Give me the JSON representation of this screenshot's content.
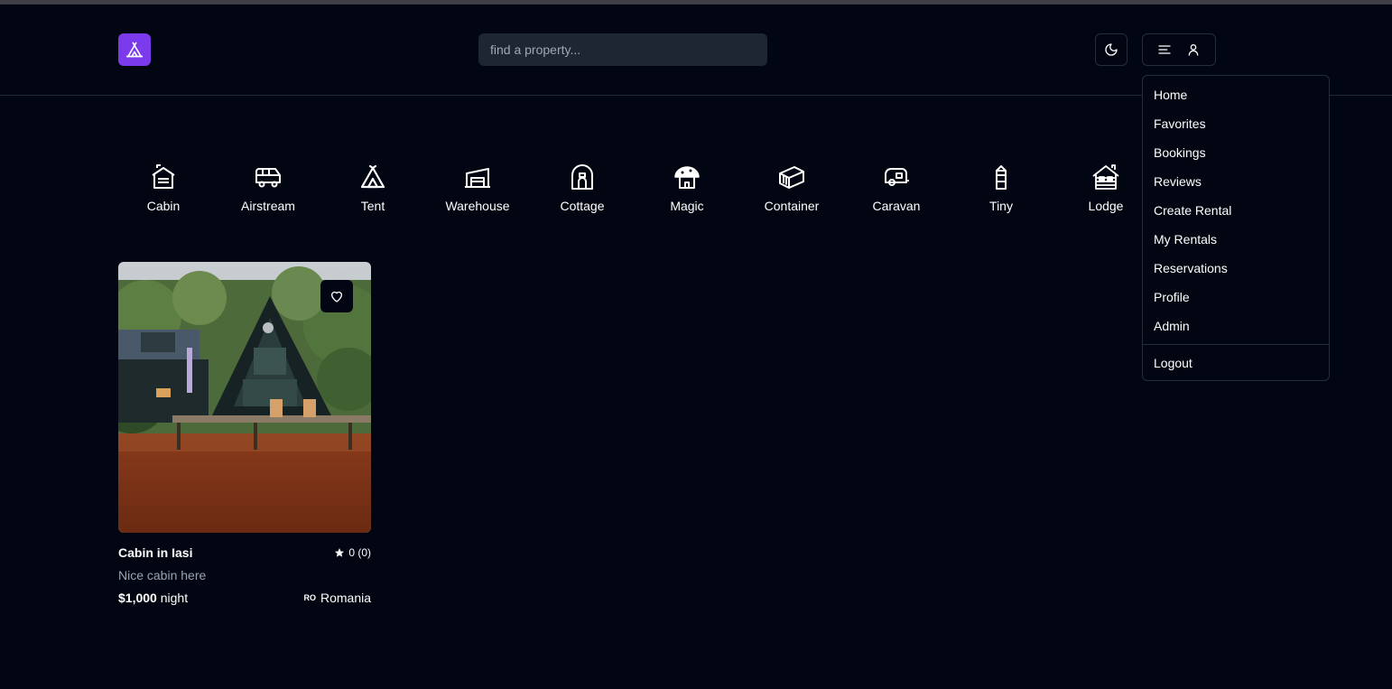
{
  "header": {
    "logo_icon": "tent-icon",
    "search_placeholder": "find a property...",
    "theme_icon": "moon-icon",
    "menu_icon": "menu-lines-icon",
    "user_icon": "user-icon"
  },
  "menu": {
    "items": [
      "Home",
      "Favorites",
      "Bookings",
      "Reviews",
      "Create Rental",
      "My Rentals",
      "Reservations",
      "Profile",
      "Admin"
    ],
    "logout": "Logout"
  },
  "categories": [
    {
      "label": "Cabin",
      "icon": "cabin-icon"
    },
    {
      "label": "Airstream",
      "icon": "airstream-icon"
    },
    {
      "label": "Tent",
      "icon": "tent-icon"
    },
    {
      "label": "Warehouse",
      "icon": "warehouse-icon"
    },
    {
      "label": "Cottage",
      "icon": "cottage-icon"
    },
    {
      "label": "Magic",
      "icon": "mushroom-house-icon"
    },
    {
      "label": "Container",
      "icon": "container-icon"
    },
    {
      "label": "Caravan",
      "icon": "caravan-icon"
    },
    {
      "label": "Tiny",
      "icon": "tiny-house-icon"
    },
    {
      "label": "Lodge",
      "icon": "lodge-icon"
    }
  ],
  "listing": {
    "title": "Cabin in Iasi",
    "rating": "0 (0)",
    "description": "Nice cabin here",
    "price": "$1,000",
    "price_unit": "night",
    "country_code": "RO",
    "country": "Romania"
  },
  "colors": {
    "background": "#020612",
    "accent": "#7c3aed",
    "search_bg": "#1e2533",
    "border": "#262d3a",
    "muted_text": "#9ca3af"
  }
}
